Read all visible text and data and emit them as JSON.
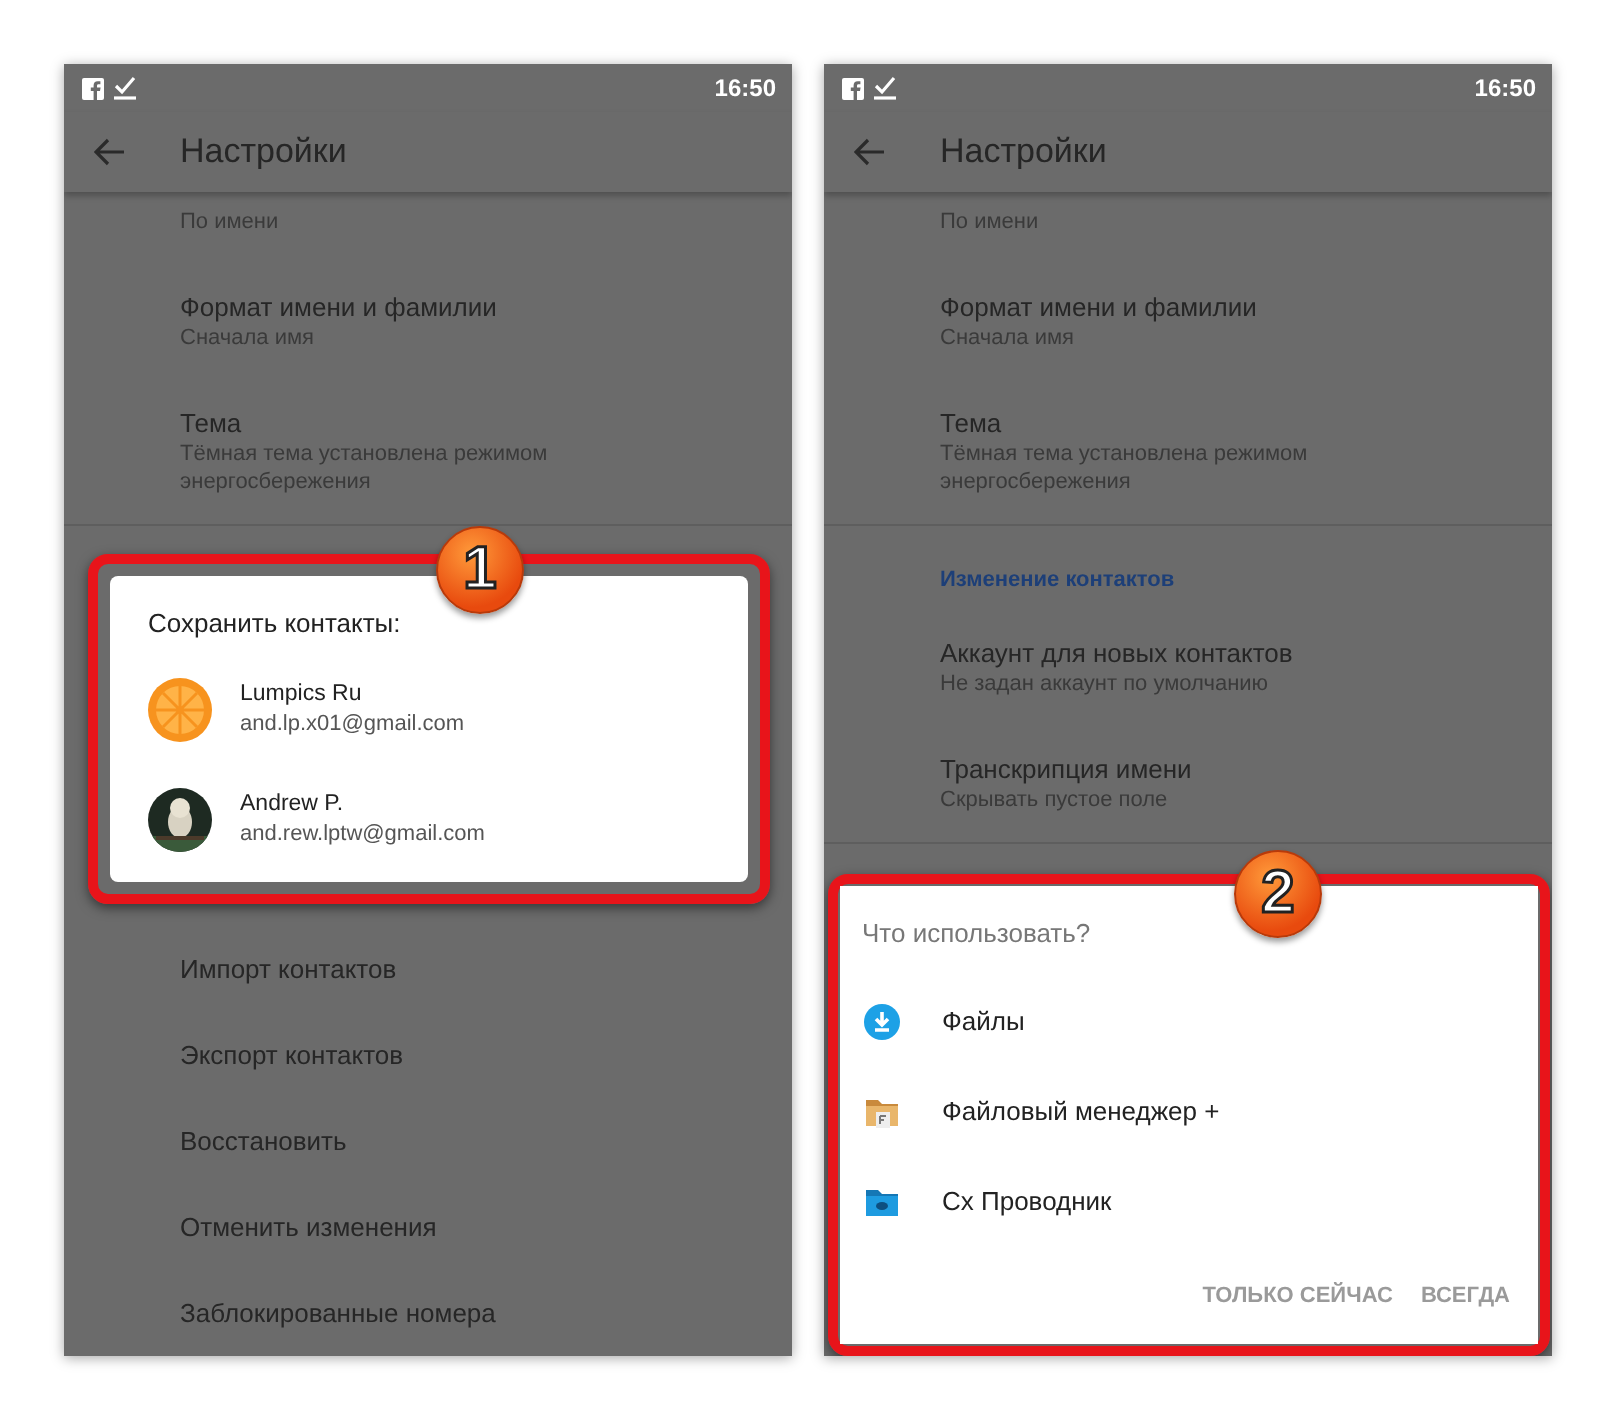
{
  "screens": [
    {
      "status_bar": {
        "time": "16:50"
      },
      "app_bar": {
        "title": "Настройки"
      },
      "list_above": [
        {
          "kind": "item",
          "subtitle": "По имени"
        },
        {
          "kind": "item",
          "title": "Формат имени и фамилии",
          "subtitle": "Сначала имя"
        },
        {
          "kind": "item",
          "title": "Тема",
          "subtitle": "Тёмная тема установлена режимом энергосбережения"
        },
        {
          "kind": "divider"
        }
      ],
      "list_below": [
        {
          "kind": "item",
          "title": "Импорт контактов"
        },
        {
          "kind": "item",
          "title": "Экспорт контактов"
        },
        {
          "kind": "item",
          "title": "Восстановить"
        },
        {
          "kind": "item",
          "title": "Отменить изменения"
        },
        {
          "kind": "item",
          "title": "Заблокированные номера"
        }
      ],
      "dialog": {
        "kind": "account_picker",
        "title": "Сохранить контакты:",
        "accounts": [
          {
            "kind": "icon",
            "name": "Lumpics Ru",
            "email": "and.lp.x01@gmail.com"
          },
          {
            "name": "Andrew P.",
            "email": "and.rew.lptw@gmail.com"
          }
        ]
      },
      "callout": {
        "number": "1"
      }
    },
    {
      "status_bar": {
        "time": "16:50"
      },
      "app_bar": {
        "title": "Настройки"
      },
      "list_above": [
        {
          "kind": "item",
          "subtitle": "По имени"
        },
        {
          "kind": "item",
          "title": "Формат имени и фамилии",
          "subtitle": "Сначала имя"
        },
        {
          "kind": "item",
          "title": "Тема",
          "subtitle": "Тёмная тема установлена режимом энергосбережения"
        },
        {
          "kind": "divider"
        },
        {
          "kind": "header",
          "title": "Изменение контактов"
        },
        {
          "kind": "item",
          "title": "Аккаунт для новых контактов",
          "subtitle": "Не задан аккаунт по умолчанию"
        },
        {
          "kind": "item",
          "title": "Транскрипция имени",
          "subtitle": "Скрывать пустое поле"
        },
        {
          "kind": "divider"
        }
      ],
      "dialog": {
        "kind": "app_chooser",
        "title": "Что использовать?",
        "apps": [
          {
            "kind": "download",
            "label": "Файлы"
          },
          {
            "kind": "folder",
            "label": "Файловый менеджер +"
          },
          {
            "kind": "explorer",
            "label": "Cx Проводник"
          }
        ],
        "buttons": [
          {
            "label": "ТОЛЬКО СЕЙЧАС",
            "disabled": true
          },
          {
            "label": "ВСЕГДА",
            "disabled": true
          }
        ]
      },
      "callout": {
        "number": "2"
      }
    }
  ]
}
